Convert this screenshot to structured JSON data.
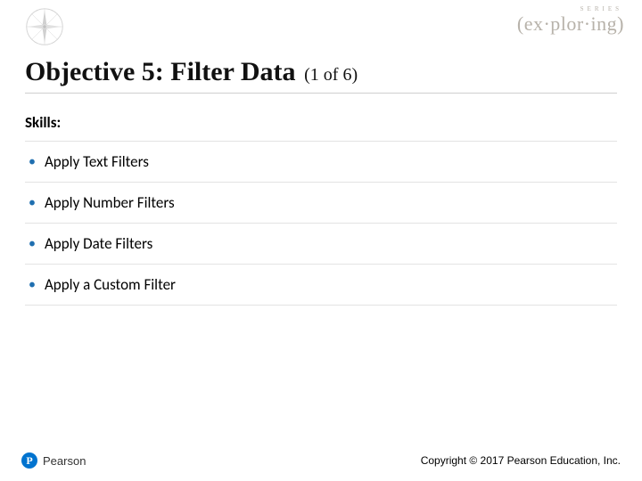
{
  "header": {
    "brand_word": "(ex·plor·ing)",
    "brand_series": "SERIES",
    "brand_tagline1": " ",
    "brand_tagline2": " "
  },
  "title": {
    "main": "Objective 5: Filter Data",
    "count": "(1 of 6)"
  },
  "skills": {
    "label": "Skills:",
    "items": [
      "Apply Text Filters",
      "Apply Number Filters",
      "Apply Date Filters",
      "Apply a Custom Filter"
    ]
  },
  "footer": {
    "publisher_mark": "P",
    "publisher_name": "Pearson",
    "copyright": "Copyright © 2017 Pearson Education, Inc."
  }
}
